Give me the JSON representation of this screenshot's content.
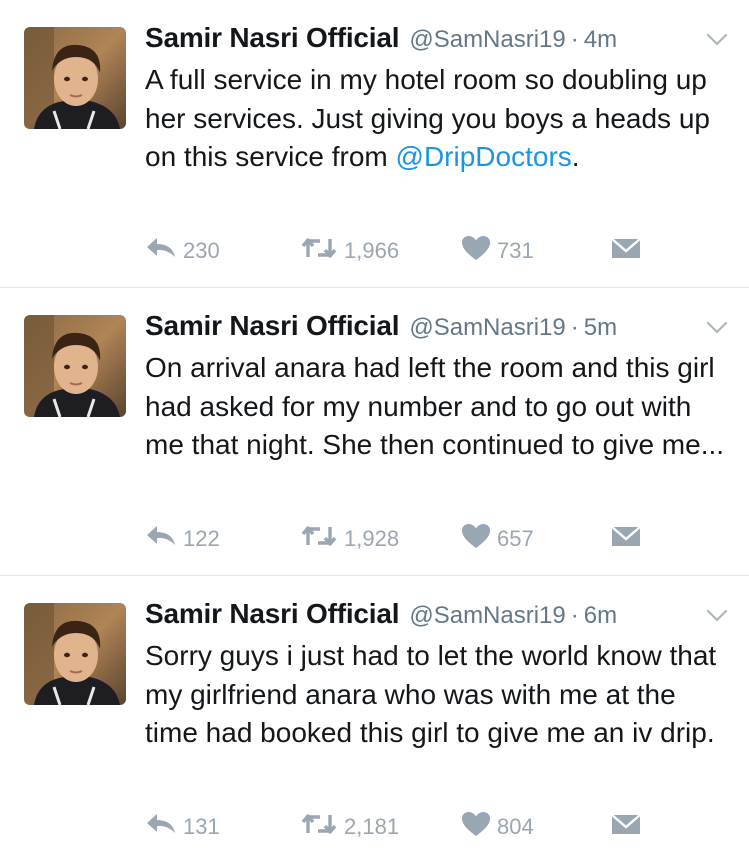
{
  "colors": {
    "text": "#14171a",
    "secondary": "#657786",
    "action_gray": "#9aa6b2",
    "mention_blue": "#1b95e0",
    "divider": "#e1e8ed"
  },
  "tweets": [
    {
      "name": "Samir Nasri Official",
      "handle": "@SamNasri19",
      "separator": "·",
      "time": "4m",
      "text_plain": "A full service in my hotel room so doubling up her services. Just giving you boys a heads up on this service from ",
      "mention": "@DripDoctors",
      "text_end": ".",
      "replies": "230",
      "retweets": "1,966",
      "likes": "731",
      "icons": [
        "reply-icon",
        "retweet-icon",
        "heart-icon",
        "dm-envelope-icon",
        "chevron-down-icon"
      ]
    },
    {
      "name": "Samir Nasri Official",
      "handle": "@SamNasri19",
      "separator": "·",
      "time": "5m",
      "text_plain": "On arrival anara had left the room and this girl had asked for my number and to go out with me that night. She then continued to give me...",
      "mention": "",
      "text_end": "",
      "replies": "122",
      "retweets": "1,928",
      "likes": "657",
      "icons": [
        "reply-icon",
        "retweet-icon",
        "heart-icon",
        "dm-envelope-icon",
        "chevron-down-icon"
      ]
    },
    {
      "name": "Samir Nasri Official",
      "handle": "@SamNasri19",
      "separator": "·",
      "time": "6m",
      "text_plain": "Sorry guys i just had to let the world know that my girlfriend anara who was with me at the time had booked this girl to give me an iv drip.",
      "mention": "",
      "text_end": "",
      "replies": "131",
      "retweets": "2,181",
      "likes": "804",
      "icons": [
        "reply-icon",
        "retweet-icon",
        "heart-icon",
        "dm-envelope-icon",
        "chevron-down-icon"
      ]
    }
  ]
}
